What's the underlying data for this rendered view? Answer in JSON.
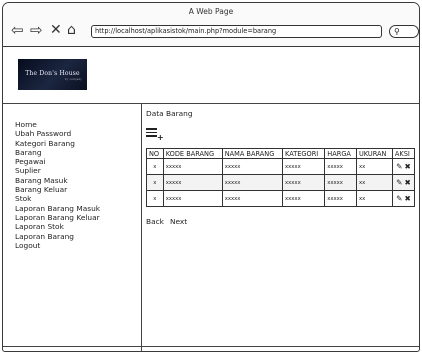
{
  "window": {
    "title": "A Web Page",
    "url": "http://localhost/aplikasistok/main.php?module=barang"
  },
  "logo": {
    "text": "The Don's House",
    "sub": "by company"
  },
  "menu": [
    "Home",
    "Ubah Password",
    "Kategori Barang",
    "Barang",
    "Pegawai",
    "Suplier",
    "Barang Masuk",
    "Barang Keluar",
    "Stok",
    "Laporan Barang Masuk",
    "Laporan Barang Keluar",
    "Laporan Stok",
    "Laporan Barang",
    "Logout"
  ],
  "content": {
    "title": "Data Barang"
  },
  "table": {
    "headers": [
      "NO",
      "KODE BARANG",
      "NAMA BARANG",
      "KATEGORI",
      "HARGA",
      "UKURAN",
      "AKSI"
    ],
    "rows": [
      [
        "x",
        "xxxxx",
        "xxxxx",
        "xxxxx",
        "xxxxx",
        "xx"
      ],
      [
        "x",
        "xxxxx",
        "xxxxx",
        "xxxxx",
        "xxxxx",
        "xx"
      ],
      [
        "x",
        "xxxxx",
        "xxxxx",
        "xxxxx",
        "xxxxx",
        "xx"
      ]
    ],
    "actions": {
      "edit": "✎",
      "delete": "✖"
    }
  },
  "pager": {
    "back": "Back",
    "next": "Next"
  }
}
